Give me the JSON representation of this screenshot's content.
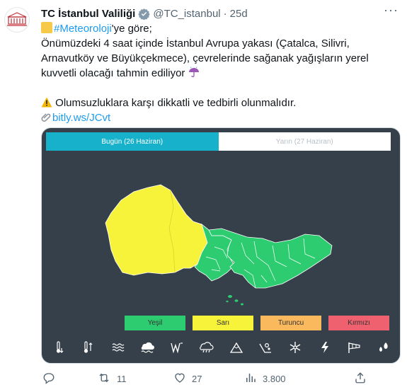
{
  "account": {
    "name": "TC İstanbul Valiliği",
    "handle": "@TC_istanbul",
    "separator": "·",
    "age": "25d",
    "more_label": "···"
  },
  "tweet": {
    "hashtag": "#Meteoroloji",
    "line1_suffix": "'ye  göre;",
    "line2": "Önümüzdeki 4 saat içinde İstanbul Avrupa yakası (Çatalca, Silivri,",
    "line3": "Arnavutköy ve Büyükçekmece), çevrelerinde sağanak yağışların yerel",
    "line4": "kuvvetli olacağı tahmin ediliyor",
    "line5": "Olumsuzluklara karşı dikkatli ve tedbirli olunmalıdır.",
    "link": "bitly.ws/JCvt"
  },
  "card": {
    "tab_today": "Bugün (26 Haziran)",
    "tab_tomorrow": "Yarın (27 Haziran)",
    "legend": {
      "green": "Yeşil",
      "yellow": "Sarı",
      "orange": "Turuncu",
      "red": "Kırmızı"
    },
    "weather_icons": [
      "temperature-icon",
      "temperature-change-icon",
      "fog-icon",
      "hail-icon",
      "wind-icon",
      "rain-icon",
      "mountain-icon",
      "avalanche-icon",
      "snow-icon",
      "lightning-icon",
      "windsock-icon",
      "downpour-icon"
    ]
  },
  "colors": {
    "link": "#1d9bf0",
    "card_bg": "#36404a",
    "tab_active": "#17b1cc",
    "green": "#2ecc71",
    "yellow": "#f7f23a",
    "orange": "#f9b95c",
    "red": "#f0616f"
  },
  "actions": {
    "reply_count": "",
    "retweet_count": "11",
    "like_count": "27",
    "views_count": "3.800"
  }
}
